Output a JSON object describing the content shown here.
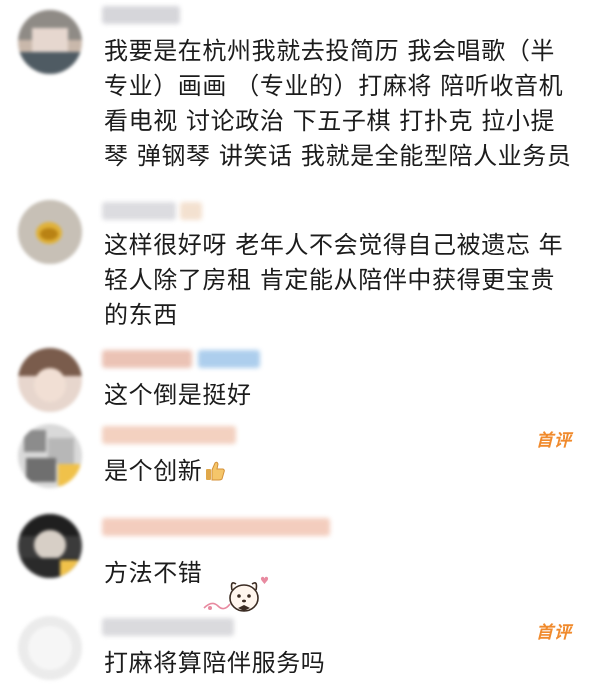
{
  "comments": [
    {
      "text": "我要是在杭州我就去投简历 我会唱歌（半专业）画画 （专业的）打麻将 陪听收音机 看电视 讨论政治 下五子棋 打扑克 拉小提琴 弹钢琴 讲笑话 我就是全能型陪人业务员"
    },
    {
      "text": "这样很好呀 老年人不会觉得自己被遗忘 年轻人除了房租 肯定能从陪伴中获得更宝贵的东西"
    },
    {
      "text": "这个倒是挺好"
    },
    {
      "text": "是个创新",
      "badge": "首评",
      "emoji": "thumbs-up-icon"
    },
    {
      "text": "方法不错",
      "sticker": "cute-dog-sticker"
    },
    {
      "text": "打麻将算陪伴服务吗",
      "badge": "首评"
    }
  ],
  "colors": {
    "badge": "#f08a2c",
    "text": "#1c1c1c",
    "background": "#ffffff"
  }
}
